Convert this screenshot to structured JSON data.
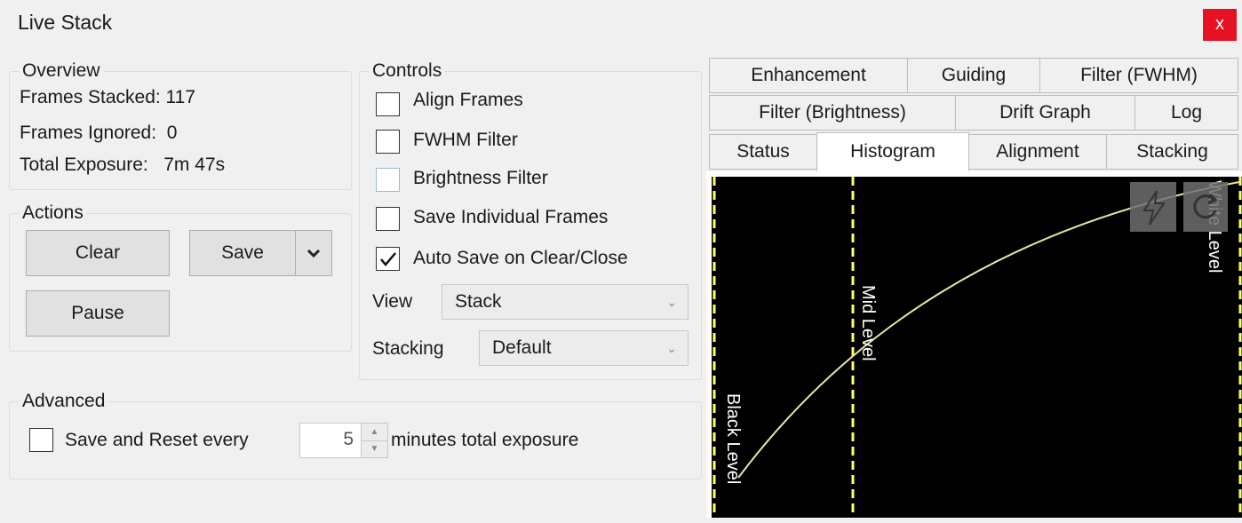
{
  "window": {
    "title": "Live Stack",
    "close_label": "x"
  },
  "overview": {
    "legend": "Overview",
    "frames_stacked": "Frames Stacked: 117",
    "frames_ignored": "Frames Ignored:  0",
    "total_exposure": "Total Exposure:   7m 47s"
  },
  "actions": {
    "legend": "Actions",
    "clear": "Clear",
    "save": "Save",
    "pause": "Pause"
  },
  "controls": {
    "legend": "Controls",
    "align_frames": "Align Frames",
    "fwhm_filter": "FWHM Filter",
    "brightness_filter": "Brightness Filter",
    "save_individual": "Save Individual Frames",
    "auto_save": "Auto Save on Clear/Close",
    "view_label": "View",
    "view_value": "Stack",
    "stacking_label": "Stacking",
    "stacking_value": "Default"
  },
  "advanced": {
    "legend": "Advanced",
    "save_reset": "Save and Reset every",
    "minutes_value": "5",
    "minutes_label": "minutes total exposure"
  },
  "tabs": {
    "enhancement": "Enhancement",
    "guiding": "Guiding",
    "filter_fwhm": "Filter (FWHM)",
    "filter_brightness": "Filter (Brightness)",
    "drift_graph": "Drift Graph",
    "log": "Log",
    "status": "Status",
    "histogram": "Histogram",
    "alignment": "Alignment",
    "stacking": "Stacking"
  },
  "histogram": {
    "black_level": "Black Level",
    "mid_level": "Mid Level",
    "white_level": "White Level",
    "curve_color": "#e6e6a0",
    "marker_color": "#ffff66"
  }
}
